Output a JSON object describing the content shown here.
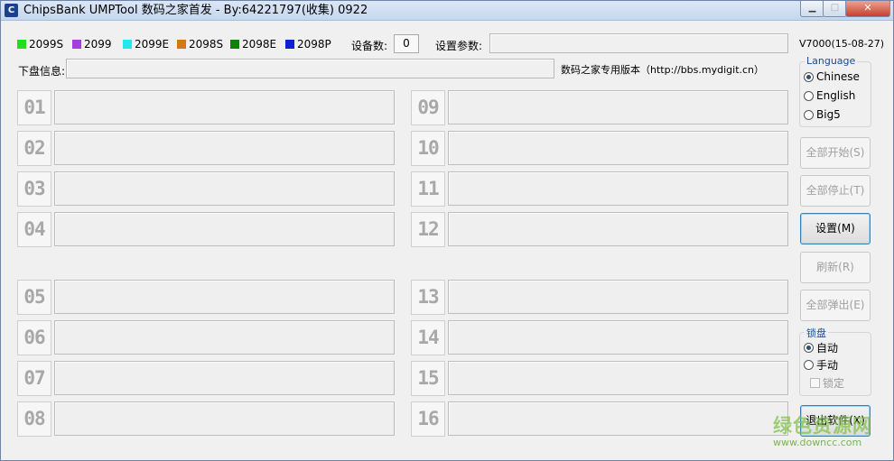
{
  "window": {
    "title": "ChipsBank UMPTool 数码之家首发 - By:64221797(收集) 0922",
    "icon": "chipsbank-app-icon",
    "minimize_glyph": "▁",
    "maximize_glyph": "□",
    "close_glyph": "✕"
  },
  "legend": [
    {
      "label": "2099S",
      "color": "#22dd22"
    },
    {
      "label": "2099",
      "color": "#a040e0"
    },
    {
      "label": "2099E",
      "color": "#22e8e8"
    },
    {
      "label": "2098S",
      "color": "#d07818"
    },
    {
      "label": "2098E",
      "color": "#108010"
    },
    {
      "label": "2098P",
      "color": "#1020d8"
    }
  ],
  "device_count": {
    "label": "设备数:",
    "value": "0"
  },
  "settings_params": {
    "label": "设置参数:",
    "value": ""
  },
  "version": "V7000(15-08-27)",
  "disk_info": {
    "label": "下盘信息:",
    "value": ""
  },
  "edition_note": "数码之家专用版本（http://bbs.mydigit.cn）",
  "slots_left": [
    {
      "num": "01"
    },
    {
      "num": "02"
    },
    {
      "num": "03"
    },
    {
      "num": "04"
    },
    {
      "num": "05"
    },
    {
      "num": "06"
    },
    {
      "num": "07"
    },
    {
      "num": "08"
    }
  ],
  "slots_right": [
    {
      "num": "09"
    },
    {
      "num": "10"
    },
    {
      "num": "11"
    },
    {
      "num": "12"
    },
    {
      "num": "13"
    },
    {
      "num": "14"
    },
    {
      "num": "15"
    },
    {
      "num": "16"
    }
  ],
  "language": {
    "title": "Language",
    "options": [
      "Chinese",
      "English",
      "Big5"
    ],
    "selected": "Chinese"
  },
  "buttons": {
    "start_all": "全部开始(S)",
    "stop_all": "全部停止(T)",
    "settings": "设置(M)",
    "refresh": "刷新(R)",
    "eject_all": "全部弹出(E)",
    "exit": "退出软件(X)"
  },
  "lock": {
    "title": "锁盘",
    "options": [
      "自动",
      "手动"
    ],
    "selected": "自动",
    "lock_check": "锁定"
  },
  "watermark": {
    "top": "绿色资源网",
    "bottom": "www.downcc.com"
  },
  "colors": {
    "accent_blue": "#3c7fb1",
    "window_bg": "#f0f0f0"
  }
}
